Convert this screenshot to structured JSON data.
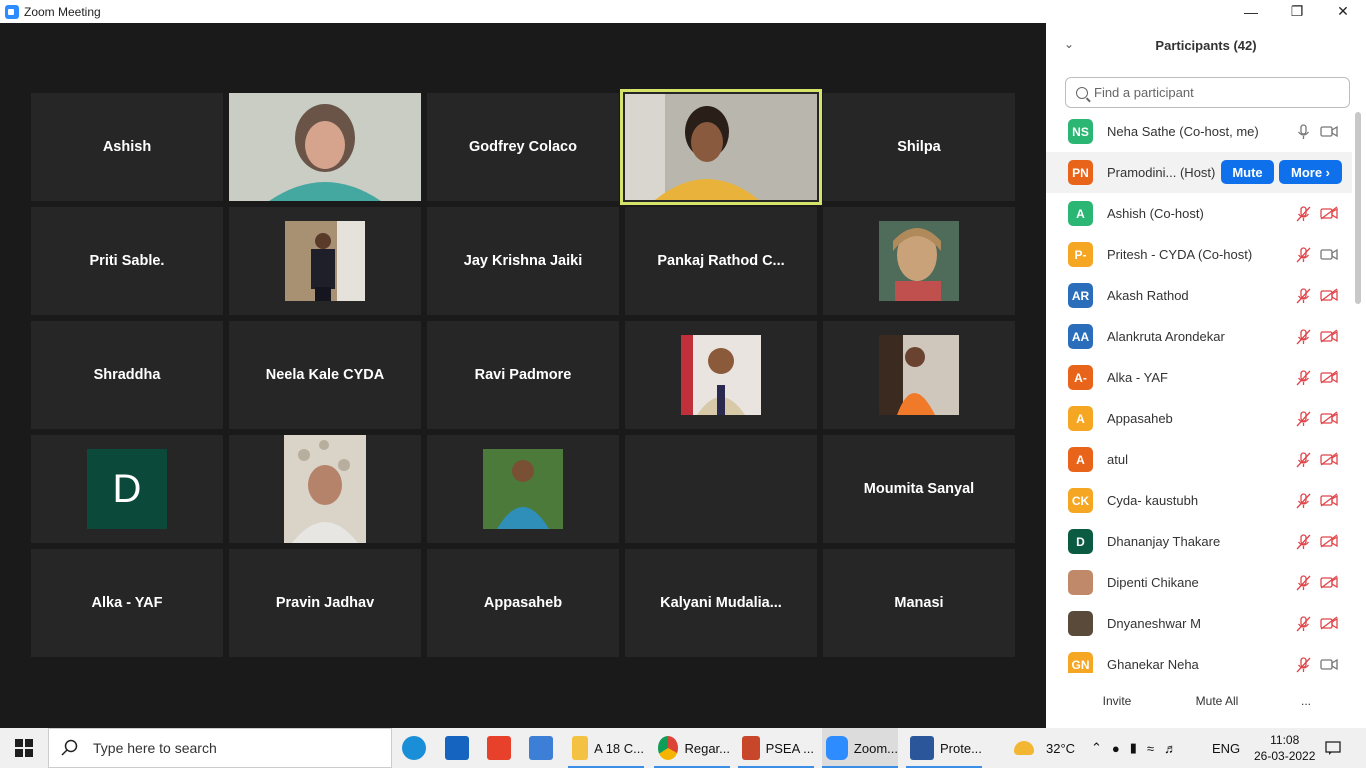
{
  "window": {
    "title": "Zoom Meeting"
  },
  "gallery": {
    "tiles": [
      {
        "name": "Ashish"
      },
      {
        "name": ""
      },
      {
        "name": "Godfrey Colaco"
      },
      {
        "name": ""
      },
      {
        "name": "Shilpa"
      },
      {
        "name": "Priti Sable."
      },
      {
        "name": ""
      },
      {
        "name": "Jay Krishna Jaiki"
      },
      {
        "name": "Pankaj  Rathod  C..."
      },
      {
        "name": ""
      },
      {
        "name": "Shraddha"
      },
      {
        "name": "Neela Kale CYDA"
      },
      {
        "name": "Ravi Padmore"
      },
      {
        "name": ""
      },
      {
        "name": ""
      },
      {
        "name": ""
      },
      {
        "name": ""
      },
      {
        "name": ""
      },
      {
        "name": ""
      },
      {
        "name": "Moumita Sanyal"
      },
      {
        "name": "Alka - YAF"
      },
      {
        "name": "Pravin Jadhav"
      },
      {
        "name": "Appasaheb"
      },
      {
        "name": "Kalyani  Mudalia..."
      },
      {
        "name": "Manasi"
      }
    ],
    "d_avatar_letter": "D"
  },
  "participants": {
    "title": "Participants (42)",
    "search_placeholder": "Find a participant",
    "mute_label": "Mute",
    "more_label": "More ›",
    "list": [
      {
        "initials": "NS",
        "name": "Neha Sathe (Co-host, me)",
        "color": "#2bb673"
      },
      {
        "initials": "PN",
        "name": "Pramodini...  (Host)",
        "color": "#e8641b"
      },
      {
        "initials": "A",
        "name": "Ashish (Co-host)",
        "color": "#2bb673"
      },
      {
        "initials": "P-",
        "name": "Pritesh - CYDA (Co-host)",
        "color": "#f5a623"
      },
      {
        "initials": "AR",
        "name": "Akash Rathod",
        "color": "#2a6ebb"
      },
      {
        "initials": "AA",
        "name": "Alankruta Arondekar",
        "color": "#2a6ebb"
      },
      {
        "initials": "A-",
        "name": "Alka - YAF",
        "color": "#e8641b"
      },
      {
        "initials": "A",
        "name": "Appasaheb",
        "color": "#f5a623"
      },
      {
        "initials": "A",
        "name": "atul",
        "color": "#e8641b"
      },
      {
        "initials": "CK",
        "name": "Cyda- kaustubh",
        "color": "#f5a623"
      },
      {
        "initials": "D",
        "name": "Dhananjay Thakare",
        "color": "#0b5b43"
      },
      {
        "initials": "",
        "name": "Dipenti Chikane",
        "color": "#c08a6a"
      },
      {
        "initials": "",
        "name": "Dnyaneshwar M",
        "color": "#5a4a3a"
      },
      {
        "initials": "GN",
        "name": "Ghanekar Neha",
        "color": "#f5a623"
      }
    ],
    "footer": {
      "invite": "Invite",
      "mute_all": "Mute All",
      "more": "..."
    }
  },
  "taskbar": {
    "search_placeholder": "Type here to search",
    "apps": [
      {
        "label": "A 18 C..."
      },
      {
        "label": "Regar..."
      },
      {
        "label": "PSEA ..."
      },
      {
        "label": "Zoom..."
      },
      {
        "label": "Prote..."
      }
    ],
    "weather": "32°C",
    "lang": "ENG",
    "time": "11:08",
    "date": "26-03-2022"
  },
  "colors": {
    "accent": "#0e71eb",
    "active_speaker": "#d6e36a",
    "muted_red": "#e0454a"
  }
}
